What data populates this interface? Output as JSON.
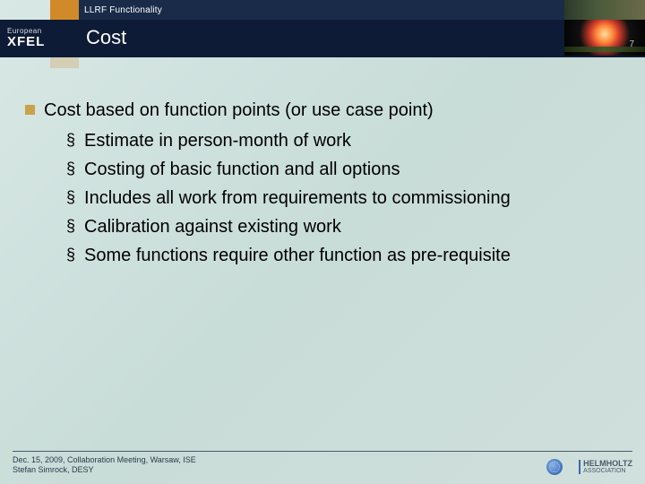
{
  "header": {
    "breadcrumb": "LLRF Functionality",
    "logo_top": "European",
    "logo_main": "XFEL",
    "title": "Cost",
    "slide_number": "7"
  },
  "content": {
    "main_point": "Cost based on function points (or use case point)",
    "sub_points": [
      "Estimate in person-month of work",
      "Costing of basic function and all options",
      "Includes all work from requirements to commissioning",
      "Calibration against existing work",
      "Some functions require other function as pre-requisite"
    ]
  },
  "footer": {
    "line1": "Dec. 15, 2009, Collaboration Meeting, Warsaw, ISE",
    "line2": "Stefan Simrock, DESY",
    "assoc_top": "HELMHOLTZ",
    "assoc_bottom": "ASSOCIATION"
  }
}
